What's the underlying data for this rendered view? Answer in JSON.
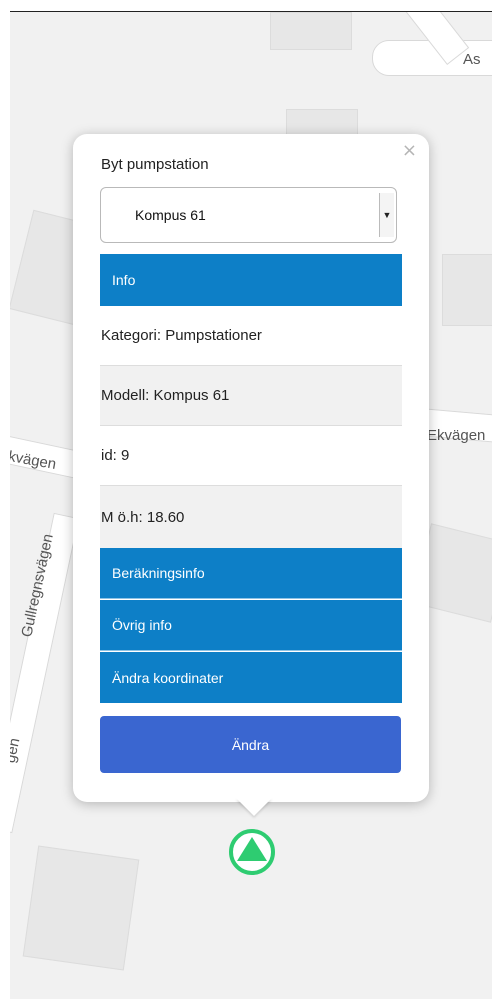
{
  "map": {
    "road_labels": [
      "As",
      "Ekvägen",
      "kvägen",
      "Gullregnsvägen",
      "gen"
    ]
  },
  "popup": {
    "close_glyph": "×",
    "title": "Byt pumpstation",
    "select_value": "Kompus 61",
    "select_arrow": "▼",
    "info_header": "Info",
    "info_rows": [
      "Kategori: Pumpstationer",
      "Modell: Kompus 61",
      "id: 9",
      "M ö.h: 18.60"
    ],
    "sections": [
      "Beräkningsinfo",
      "Övrig info",
      "Ändra koordinater"
    ],
    "edit_button": "Ändra"
  },
  "marker": {
    "icon": "pump-station-marker-icon",
    "color": "#2ecc71"
  },
  "colors": {
    "header": "#0d7fc7",
    "button": "#3a66d0",
    "map_bg": "#f1f1f1"
  }
}
